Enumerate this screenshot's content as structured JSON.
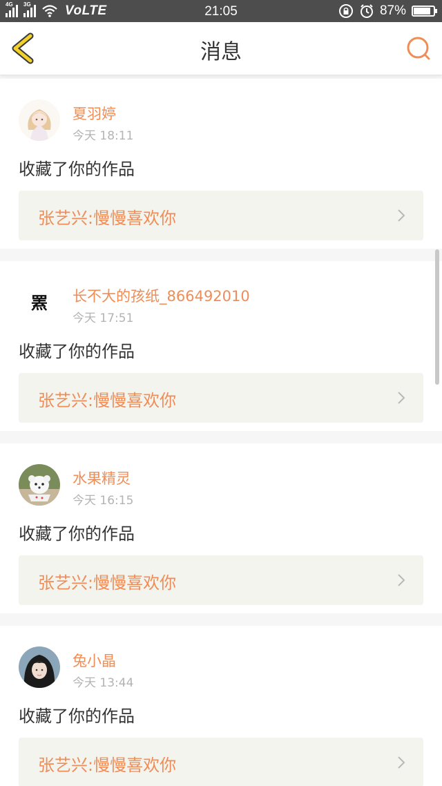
{
  "status_bar": {
    "signal1_tag": "4G",
    "signal2_tag": "3G",
    "network": "VoLTE",
    "time": "21:05",
    "battery": "87%",
    "battery_level": 0.87
  },
  "nav": {
    "title": "消息",
    "accent_color": "#ee8d57",
    "back_color": "#f2d12a"
  },
  "messages": [
    {
      "user": "夏羽婷",
      "time": "今天 18:11",
      "action": "收藏了你的作品",
      "work": "张艺兴:慢慢喜欢你",
      "avatar": "anime-girl-avatar"
    },
    {
      "user": "长不大的孩纸_866492010",
      "time": "今天 17:51",
      "action": "收藏了你的作品",
      "work": "张艺兴:慢慢喜欢你",
      "avatar": "text-avatar",
      "avatar_text": "罴"
    },
    {
      "user": "水果精灵",
      "time": "今天 16:15",
      "action": "收藏了你的作品",
      "work": "张艺兴:慢慢喜欢你",
      "avatar": "puppy-photo-avatar"
    },
    {
      "user": "兔小晶",
      "time": "今天 13:44",
      "action": "收藏了你的作品",
      "work": "张艺兴:慢慢喜欢你",
      "avatar": "girl-photo-avatar"
    }
  ]
}
